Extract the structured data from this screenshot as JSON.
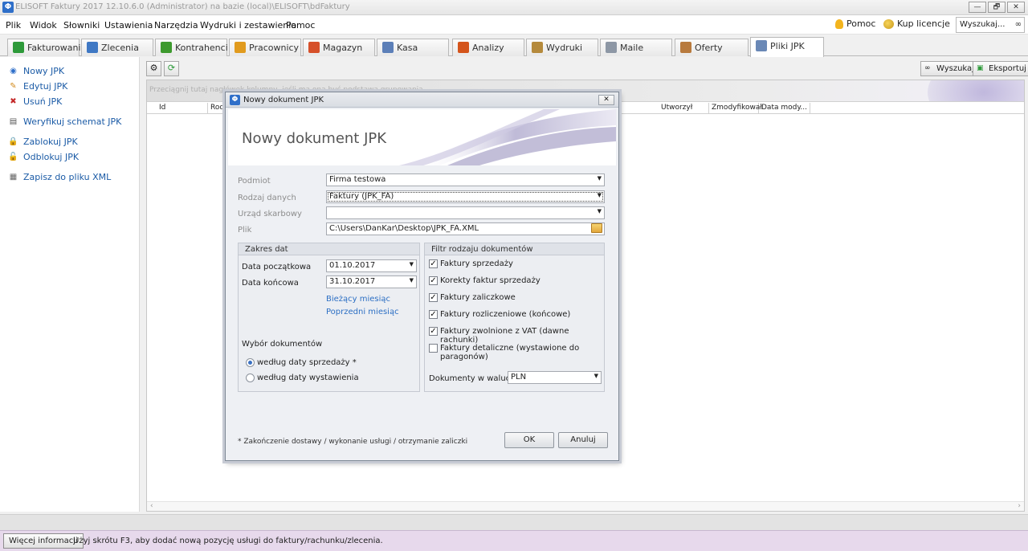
{
  "window": {
    "title": "ELISOFT Faktury 2017 12.10.6.0  (Administrator) na bazie (local)\\ELISOFT\\bdFaktury",
    "buttons": [
      "—",
      "🗗",
      "✕"
    ]
  },
  "menu": {
    "items": [
      "Plik",
      "Widok",
      "Słowniki",
      "Ustawienia",
      "Narzędzia",
      "Wydruki i zestawienia",
      "Pomoc"
    ],
    "help": "Pomoc",
    "buy_license": "Kup licencje",
    "search_value": "Wyszukaj..."
  },
  "tabs": [
    {
      "label": "Fakturowanie",
      "color": "#2e9a3a"
    },
    {
      "label": "Zlecenia",
      "color": "#3f78c4"
    },
    {
      "label": "Kontrahenci",
      "color": "#3d9a2e"
    },
    {
      "label": "Pracownicy",
      "color": "#e19b1e"
    },
    {
      "label": "Magazyn",
      "color": "#d6502a"
    },
    {
      "label": "Kasa",
      "color": "#5c7fb8"
    },
    {
      "label": "Analizy",
      "color": "#d4541b"
    },
    {
      "label": "Wydruki",
      "color": "#b58a3c"
    },
    {
      "label": "Maile",
      "color": "#8d97a5"
    },
    {
      "label": "Oferty",
      "color": "#b87a3d"
    },
    {
      "label": "Pliki JPK",
      "color": "#6a88b6"
    }
  ],
  "sidebar": {
    "items": [
      {
        "label": "Nowy JPK",
        "icon": "new-document-icon"
      },
      {
        "label": "Edytuj JPK",
        "icon": "edit-icon"
      },
      {
        "label": "Usuń JPK",
        "icon": "delete-icon"
      },
      {
        "label": "Weryfikuj schemat JPK",
        "icon": "verify-icon"
      },
      {
        "label": "Zablokuj JPK",
        "icon": "lock-icon"
      },
      {
        "label": "Odblokuj JPK",
        "icon": "unlock-icon"
      },
      {
        "label": "Zapisz do pliku XML",
        "icon": "xml-file-icon"
      }
    ]
  },
  "toolbar": {
    "search_label": "Wyszukaj",
    "export_label": "Eksportuj"
  },
  "grid": {
    "group_hint": "Przeciągnij tutaj nagłówek kolumny, jeśli ma ona być podstawą grupowania",
    "columns": [
      "Id",
      "Rodz",
      "Utworzył",
      "Zmodyfikował",
      "Data mody..."
    ]
  },
  "status": {
    "more_info": "Więcej informacji",
    "text": "Użyj skrótu F3, aby dodać nową pozycję usługi do faktury/rachunku/zlecenia."
  },
  "dialog": {
    "title": "Nowy dokument JPK",
    "header": "Nowy dokument JPK",
    "fields": {
      "podmiot_label": "Podmiot",
      "podmiot_value": "Firma testowa",
      "rodzaj_label": "Rodzaj danych",
      "rodzaj_value": "Faktury (JPK_FA)",
      "urzad_label": "Urząd skarbowy",
      "urzad_value": "",
      "plik_label": "Plik",
      "plik_value": "C:\\Users\\DanKar\\Desktop\\JPK_FA.XML"
    },
    "date_range": {
      "title": "Zakres dat",
      "start_label": "Data początkowa",
      "start_value": "01.10.2017",
      "end_label": "Data końcowa",
      "end_value": "31.10.2017",
      "current_month": "Bieżący miesiąc",
      "previous_month": "Poprzedni miesiąc",
      "selection_label": "Wybór dokumentów",
      "radio_sale": "według daty sprzedaży *",
      "radio_issue": "według daty wystawienia"
    },
    "filter": {
      "title": "Filtr rodzaju dokumentów",
      "options": [
        {
          "label": "Faktury sprzedaży",
          "checked": true
        },
        {
          "label": "Korekty faktur sprzedaży",
          "checked": true
        },
        {
          "label": "Faktury zaliczkowe",
          "checked": true
        },
        {
          "label": "Faktury rozliczeniowe (końcowe)",
          "checked": true
        },
        {
          "label": "Faktury zwolnione z VAT (dawne rachunki)",
          "checked": true
        },
        {
          "label": "Faktury detaliczne (wystawione do paragonów)",
          "checked": false
        }
      ],
      "currency_label": "Dokumenty w walucie",
      "currency_value": "PLN"
    },
    "footnote": "* Zakończenie dostawy / wykonanie usługi / otrzymanie zaliczki",
    "ok": "OK",
    "cancel": "Anuluj"
  }
}
